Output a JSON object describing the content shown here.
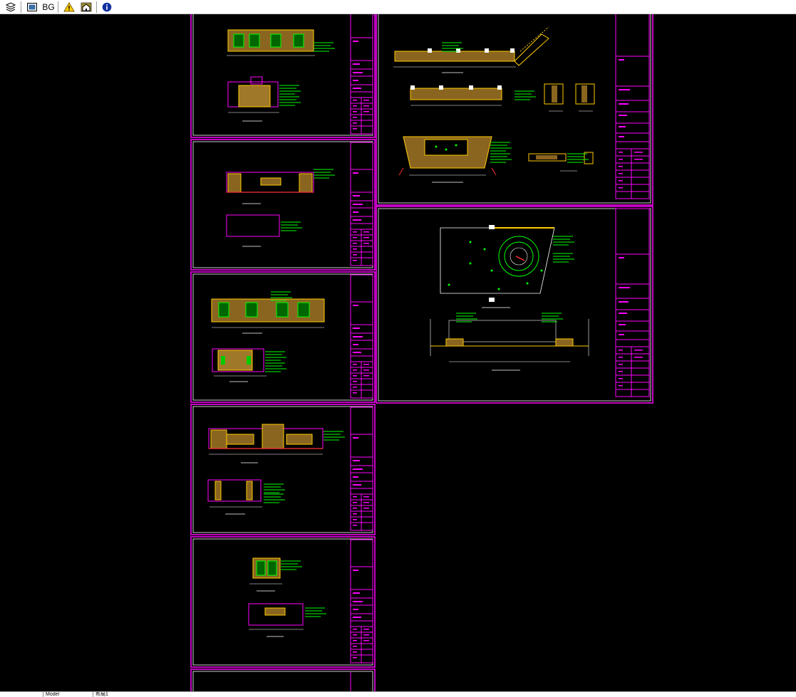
{
  "toolbar": {
    "buttons": [
      {
        "name": "layers-icon",
        "label": ""
      },
      {
        "name": "display-icon",
        "label": ""
      },
      {
        "name": "bg-button",
        "label": "BG"
      },
      {
        "name": "warning-icon",
        "label": ""
      },
      {
        "name": "home-icon",
        "label": ""
      },
      {
        "name": "info-icon",
        "label": ""
      }
    ]
  },
  "colors": {
    "background": "#000000",
    "sheet_border": "#ff00ff",
    "inner_border": "#ffffff",
    "annotation": "#00ff00",
    "wood_fill": "#a0782a",
    "wood_edge": "#ffcc00",
    "accent_red": "#ff3030",
    "window_pane": "#00cc00"
  },
  "tabs": {
    "model_label": "Model",
    "layout_label": "布局1"
  },
  "sheets_left_count": 6,
  "sheets_right_count": 2
}
